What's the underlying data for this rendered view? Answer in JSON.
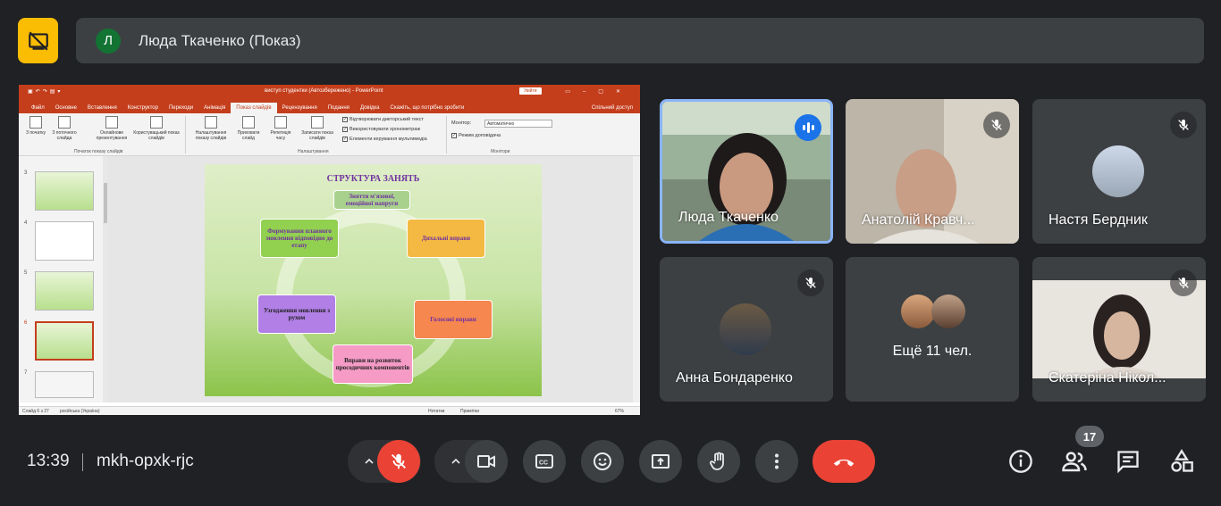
{
  "header": {
    "presenter_initial": "Л",
    "presenter_label": "Люда Ткаченко (Показ)"
  },
  "shared_screen": {
    "app_title": "виступ студентки (Автозбережено) - PowerPoint",
    "sign_in": "Увійти",
    "tabs": [
      "Файл",
      "Основне",
      "Вставлення",
      "Конструктор",
      "Переходи",
      "Анімація",
      "Показ слайдів",
      "Рецензування",
      "Подання",
      "Довідка",
      "Скажіть, що потрібно зробити"
    ],
    "active_tab": "Показ слайдів",
    "share": "Спільний доступ",
    "ribbon": {
      "from_start": "З початку",
      "from_current": "З поточного слайда",
      "online": "Онлайнове презентування",
      "custom": "Користувацький показ слайдів",
      "setup": "Налаштування показу слайдів",
      "hide": "Приховати слайд",
      "rehearse": "Репетиція часу",
      "record": "Записати показ слайдів",
      "group_start": "Початок показу слайдів",
      "group_setup": "Налаштування",
      "group_monitors": "Монітори",
      "chk_narration": "Відтворювати дикторський текст",
      "chk_timings": "Використовувати хронометраж",
      "chk_media": "Елементи керування мультимедіа",
      "monitor_label": "Монітор:",
      "monitor_value": "Автоматично",
      "presenter_view": "Режим доповідача"
    },
    "thumb_numbers": [
      "3",
      "4",
      "5",
      "6",
      "7"
    ],
    "slide": {
      "title": "СТРУКТУРА ЗАНЯТЬ",
      "box_top": "Зняття м'язової, емоційної напруги",
      "box_left_top": "Формування плавного мовлення відповідно до етапу",
      "box_right_top": "Дихальні вправи",
      "box_left_bottom": "Узгодження мовлення з рухом",
      "box_right_bottom": "Голосові вправи",
      "box_bottom": "Вправи на розвиток просодичних компонентів"
    },
    "status": {
      "slide_of": "Слайд 6 з 27",
      "language": "російська (Україна)",
      "notes": "Нотатки",
      "comments": "Примітки",
      "zoom": "67%"
    }
  },
  "participants": [
    {
      "name": "Люда Ткаченко"
    },
    {
      "name": "Анатолій Кравч..."
    },
    {
      "name": "Настя Бердник"
    },
    {
      "name": "Анна Бондаренко"
    },
    {
      "name": "Ещё 11 чел."
    },
    {
      "name": "Єкатеріна Нікол..."
    }
  ],
  "footer": {
    "time": "13:39",
    "meeting_code": "mkh-opxk-rjc",
    "participant_count": "17"
  },
  "colors": {
    "background": "#202124",
    "tile": "#3c4043",
    "present_button": "#fbbc04",
    "danger": "#ea4335",
    "accent": "#8ab4f8",
    "powerpoint": "#c43e1c"
  },
  "icons": [
    "present-off-icon",
    "mic-off-icon",
    "speaking-icon",
    "camera-icon",
    "captions-icon",
    "emoji-icon",
    "present-screen-icon",
    "raise-hand-icon",
    "more-vert-icon",
    "end-call-icon",
    "info-icon",
    "people-icon",
    "chat-icon",
    "activities-icon",
    "chevron-up-icon"
  ]
}
